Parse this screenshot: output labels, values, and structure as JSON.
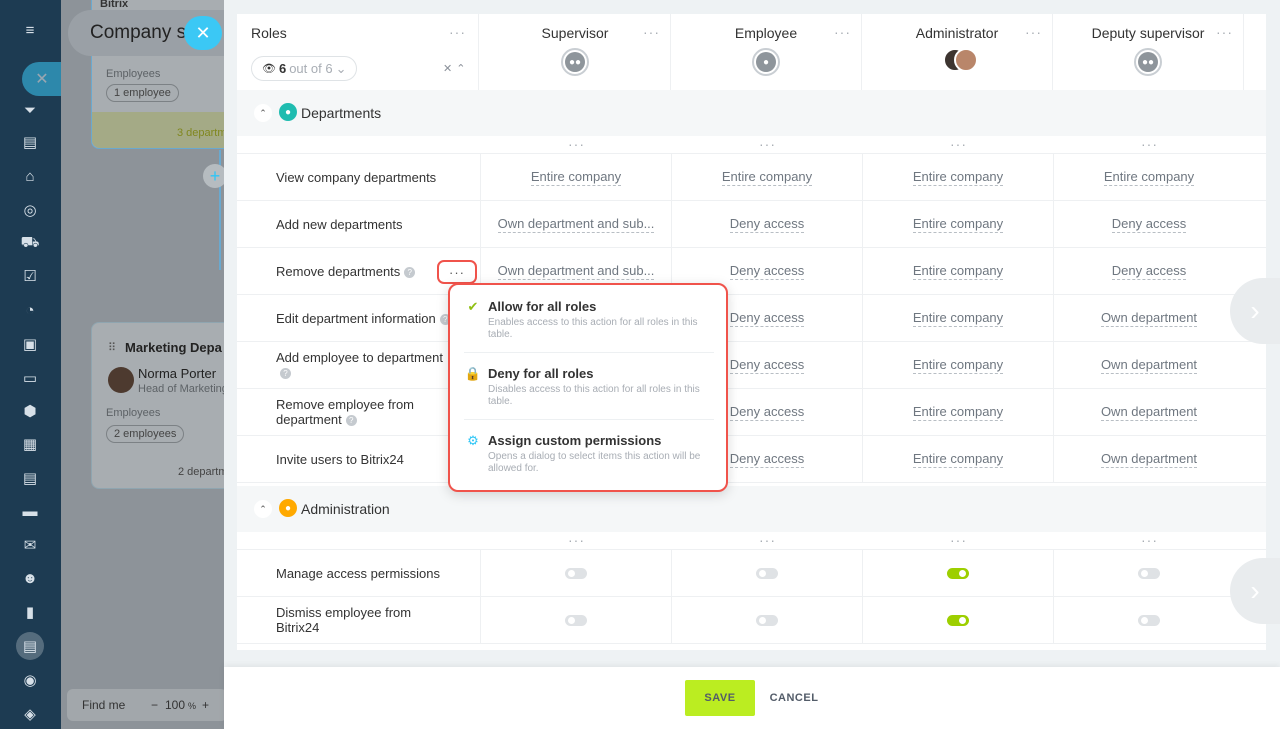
{
  "rail": {
    "icons": [
      "menu-icon",
      "chat-bubble-icon",
      "funnel-icon",
      "tasks-icon",
      "bank-icon",
      "target-icon",
      "cart-icon",
      "checklist-icon",
      "pie-icon",
      "document-icon",
      "chat-icon",
      "hexagon-icon",
      "calendar-icon",
      "file-icon",
      "inbox-icon",
      "mail-icon",
      "team-icon",
      "analytics-icon",
      "contact-card-icon",
      "android-icon",
      "box-icon"
    ],
    "glyphs": [
      "≡",
      "✕",
      "⏷",
      "▤",
      "⌂",
      "◎",
      "⛟",
      "☑",
      "◔",
      "▣",
      "▭",
      "⬢",
      "▦",
      "▤",
      "▬",
      "✉",
      "☻",
      "▮",
      "▤",
      "◉",
      "◈"
    ]
  },
  "background_page": {
    "title": "Company s",
    "top_card": {
      "employees_label": "Employees",
      "employees_pill": "1 employee",
      "departments_link": "3 departm"
    },
    "mid_card": {
      "title": "Marketing Depa",
      "person_name": "Norma Porter",
      "person_role": "Head of Marketing",
      "employees_label": "Employees",
      "employees_pill": "2 employees",
      "departments_link": "2 departm"
    },
    "find_me": "Find me",
    "zoom_minus": "−",
    "zoom_value": "100",
    "zoom_unit": "%",
    "zoom_plus": "+",
    "app_name": "Bitrix"
  },
  "header": {
    "roles_label": "Roles",
    "counter": {
      "value": "6",
      "of": "out of 6",
      "chevron": "⌄"
    },
    "columns": [
      {
        "name": "Supervisor",
        "avatar": "group-icon"
      },
      {
        "name": "Employee",
        "avatar": "user-icon"
      },
      {
        "name": "Administrator",
        "avatar": "photos"
      },
      {
        "name": "Deputy supervisor",
        "avatar": "group-icon"
      }
    ]
  },
  "sections": [
    {
      "title": "Departments",
      "icon": "users-icon",
      "icon_color": "#1fbcb0",
      "rows": [
        {
          "label": "View company departments",
          "help": false,
          "values": [
            "Entire company",
            "Entire company",
            "Entire company",
            "Entire company"
          ]
        },
        {
          "label": "Add new departments",
          "help": false,
          "values": [
            "Own department and sub...",
            "Deny access",
            "Entire company",
            "Deny access"
          ]
        },
        {
          "label": "Remove departments",
          "help": true,
          "values": [
            "Own department and sub...",
            "Deny access",
            "Entire company",
            "Deny access"
          ]
        },
        {
          "label": "Edit department information",
          "help": true,
          "values": [
            "",
            "Deny access",
            "Entire company",
            "Own department"
          ]
        },
        {
          "label": "Add employee to department",
          "help": true,
          "values": [
            "",
            "Deny access",
            "Entire company",
            "Own department"
          ]
        },
        {
          "label": "Remove employee from department",
          "help": true,
          "values": [
            "",
            "Deny access",
            "Entire company",
            "Own department"
          ]
        },
        {
          "label": "Invite users to Bitrix24",
          "help": false,
          "values": [
            "",
            "Deny access",
            "Entire company",
            "Own department"
          ]
        }
      ]
    },
    {
      "title": "Administration",
      "icon": "admin-icon",
      "icon_color": "#ffa900",
      "rows": [
        {
          "label": "Manage access permissions",
          "toggles": [
            false,
            false,
            true,
            false
          ]
        },
        {
          "label": "Dismiss employee from Bitrix24",
          "toggles": [
            false,
            false,
            true,
            false
          ]
        }
      ]
    }
  ],
  "menu": {
    "items": [
      {
        "title": "Allow for all roles",
        "desc": "Enables access to this action for all roles in this table.",
        "icon": "check-icon",
        "glyph": "✔",
        "color": "#8fbf12"
      },
      {
        "title": "Deny for all roles",
        "desc": "Disables access to this action for all roles in this table.",
        "icon": "lock-icon",
        "glyph": "🔒",
        "color": "#f0534b"
      },
      {
        "title": "Assign custom permissions",
        "desc": "Opens a dialog to select items this action will be allowed for.",
        "icon": "gear-icon",
        "glyph": "⚙",
        "color": "#2fc6f6"
      }
    ]
  },
  "footer": {
    "save": "SAVE",
    "cancel": "CANCEL"
  },
  "colors": {
    "accent": "#bbed21",
    "highlight": "#f0534b",
    "toggle_on": "#9dcf00"
  }
}
